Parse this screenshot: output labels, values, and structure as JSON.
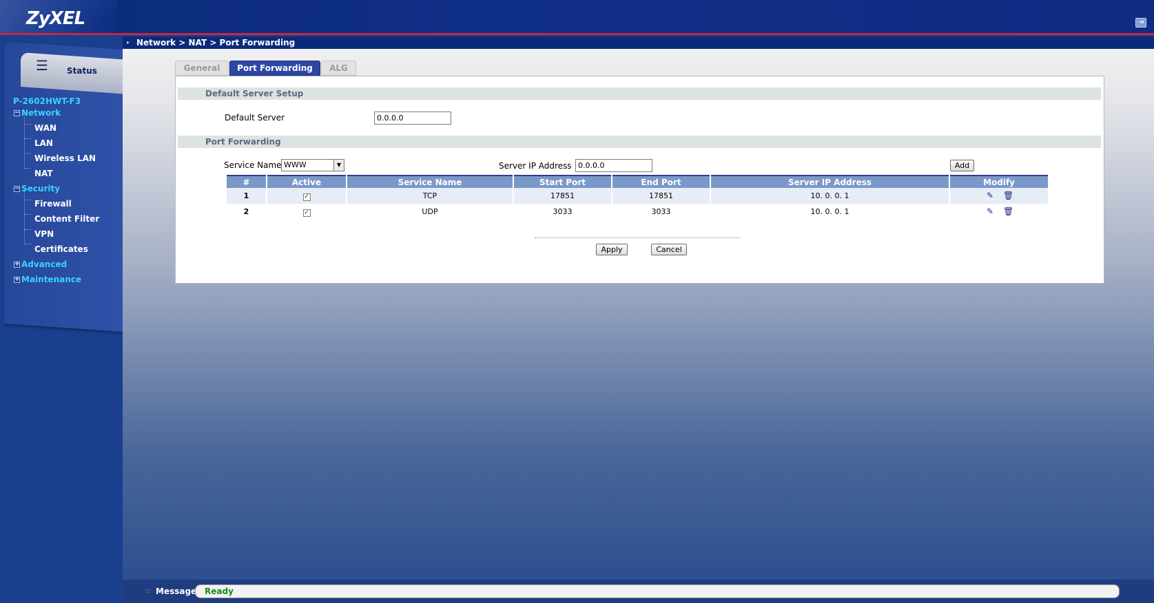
{
  "header": {
    "logo": "ZyXEL",
    "breadcrumb": "Network > NAT > Port Forwarding"
  },
  "sidebar": {
    "status_label": "Status",
    "device_name": "P-2602HWT-F3",
    "groups": [
      {
        "label": "Network",
        "expanded": true,
        "items": [
          "WAN",
          "LAN",
          "Wireless LAN",
          "NAT"
        ]
      },
      {
        "label": "Security",
        "expanded": true,
        "items": [
          "Firewall",
          "Content Filter",
          "VPN",
          "Certificates"
        ]
      },
      {
        "label": "Advanced",
        "expanded": false,
        "items": []
      },
      {
        "label": "Maintenance",
        "expanded": false,
        "items": []
      }
    ]
  },
  "tabs": [
    {
      "label": "General",
      "active": false
    },
    {
      "label": "Port Forwarding",
      "active": true
    },
    {
      "label": "ALG",
      "active": false
    }
  ],
  "default_server": {
    "section_title": "Default Server Setup",
    "field_label": "Default Server",
    "value": "0.0.0.0"
  },
  "port_forwarding": {
    "section_title": "Port Forwarding",
    "service_name_label": "Service Name",
    "service_name_value": "WWW",
    "server_ip_label": "Server IP Address",
    "server_ip_value": "0.0.0.0",
    "add_label": "Add",
    "columns": [
      "#",
      "Active",
      "Service Name",
      "Start Port",
      "End Port",
      "Server IP Address",
      "Modify"
    ],
    "rows": [
      {
        "index": "1",
        "active": true,
        "service": "TCP",
        "start_port": "17851",
        "end_port": "17851",
        "server_ip": "10. 0. 0. 1"
      },
      {
        "index": "2",
        "active": true,
        "service": "UDP",
        "start_port": "3033",
        "end_port": "3033",
        "server_ip": "10. 0. 0. 1"
      }
    ]
  },
  "buttons": {
    "apply": "Apply",
    "cancel": "Cancel"
  },
  "status_bar": {
    "label": "Message",
    "value": "Ready"
  },
  "colors": {
    "header_bg": "#0e2c82",
    "accent_red": "#c8283c",
    "nav_group": "#3ad2ff",
    "tab_active": "#2e46a6",
    "table_header": "#7a98c9",
    "status_ready": "#1b8a1b"
  }
}
